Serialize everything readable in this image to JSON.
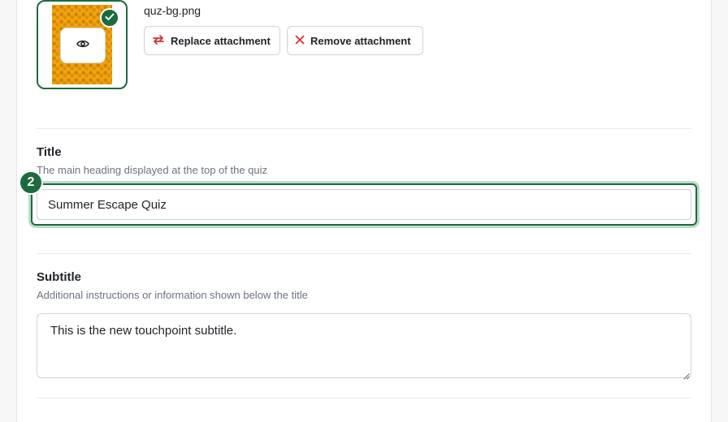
{
  "attachment": {
    "filename": "quz-bg.png",
    "replace_label": "Replace attachment",
    "remove_label": "Remove attachment",
    "preview_icon": "eye-icon",
    "selected_icon": "check-icon",
    "replace_icon": "swap-arrows-icon",
    "remove_icon": "close-icon"
  },
  "title_field": {
    "step_number": "2",
    "label": "Title",
    "help": "The main heading displayed at the top of the quiz",
    "value": "Summer Escape Quiz"
  },
  "subtitle_field": {
    "label": "Subtitle",
    "help": "Additional instructions or information shown below the title",
    "value": "This is the new touchpoint subtitle."
  },
  "colors": {
    "accent": "#1b6b3e",
    "focus_ring": "#b9dcc6",
    "danger": "#d32f2f",
    "thumbnail": "#f2a20d"
  }
}
